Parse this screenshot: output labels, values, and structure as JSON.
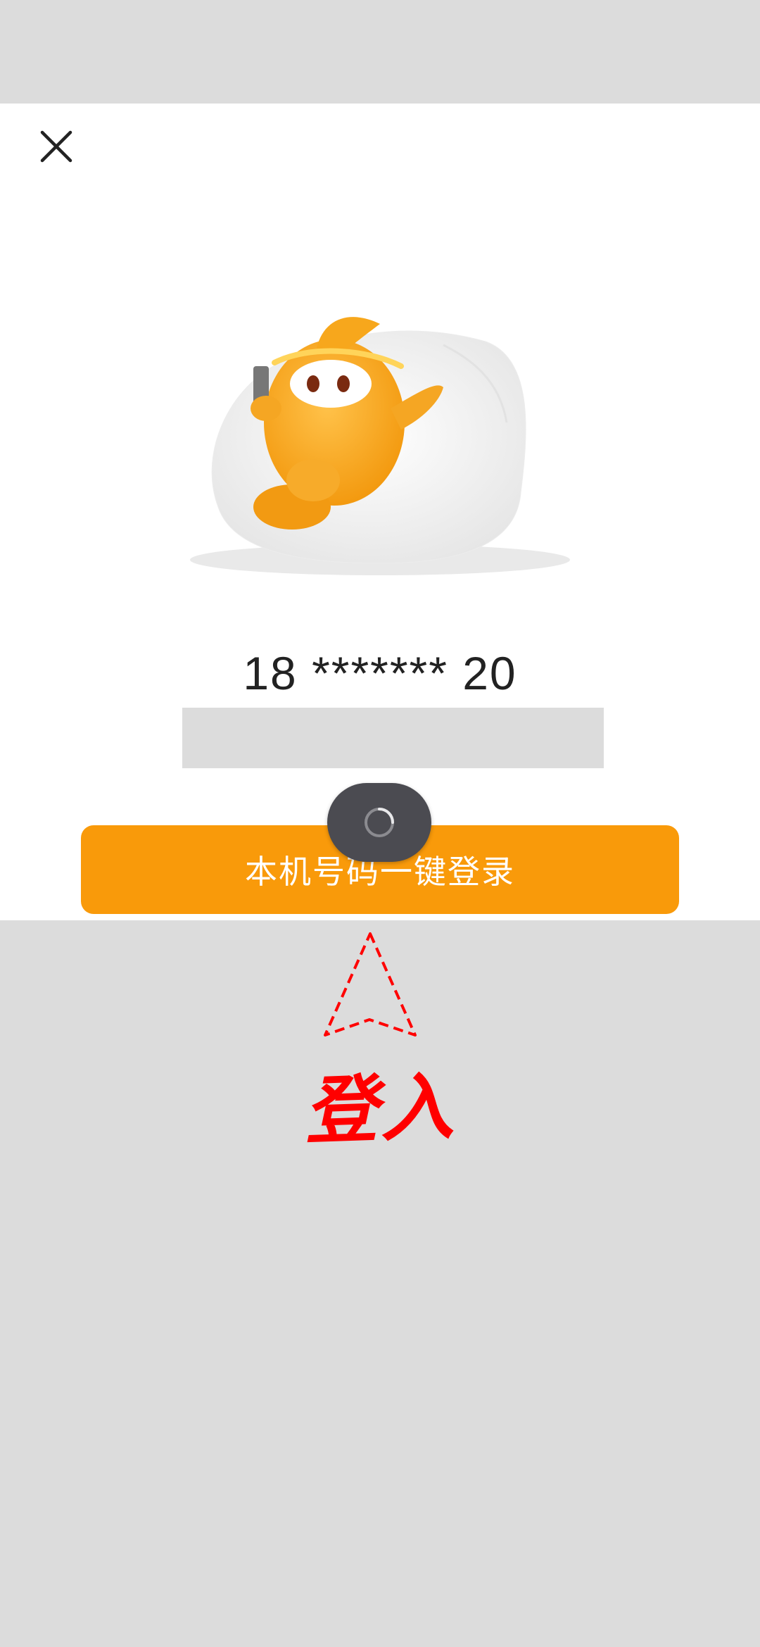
{
  "close": {
    "icon": "close-icon"
  },
  "mascot": {
    "icon": "mascot-illustration"
  },
  "phone": {
    "masked_number": "18 ******* 20"
  },
  "login": {
    "button_label": "本机号码一键登录"
  },
  "loading": {
    "icon": "spinner-icon"
  },
  "annotation": {
    "text": "登入",
    "color": "#ff0000"
  },
  "colors": {
    "accent": "#f99a0a",
    "background": "#dcdcdc",
    "sheet": "#ffffff"
  }
}
